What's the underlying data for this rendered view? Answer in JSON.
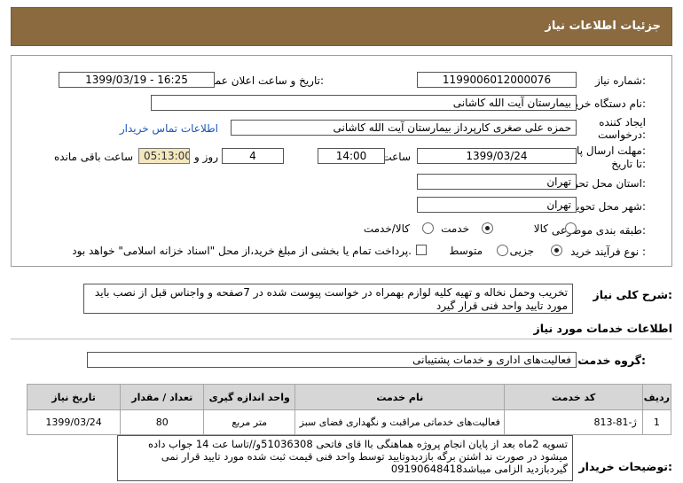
{
  "header": {
    "title": "جزئیات اطلاعات نیاز"
  },
  "form": {
    "need_number_label": "شماره نیاز:",
    "need_number": "1199006012000076",
    "announce_label": "تاریخ و ساعت اعلان عمومی:",
    "announce_value": "1399/03/19 - 16:25",
    "buyer_label": "نام دستگاه خریدار:",
    "buyer_value": "بیمارستان آیت الله کاشانی",
    "creator_label_1": "ایجاد کننده",
    "creator_label_2": "درخواست:",
    "creator_value": "حمزه علی صغری کارپرداز بیمارستان آیت الله کاشانی",
    "contact_link": "اطلاعات تماس خریدار",
    "deadline_label_1": "مهلت ارسال پاسخ:",
    "deadline_label_2": "تا تاریخ:",
    "deadline_date": "1399/03/24",
    "time_label": "ساعت",
    "deadline_time": "14:00",
    "days_value": "4",
    "days_label": "روز و",
    "remaining_value": "05:13:00",
    "remaining_label": "ساعت باقی مانده",
    "province_label": "استان محل تحویل:",
    "province_value": "تهران",
    "city_label": "شهر محل تحویل:",
    "city_value": "تهران",
    "category_label": "طبقه بندی موضوعی:",
    "category_options": [
      "کالا",
      "خدمت",
      "کالا/خدمت"
    ],
    "category_selected": "خدمت",
    "process_label": "نوع فرآیند خرید :",
    "process_options": [
      "جزیی",
      "متوسط"
    ],
    "process_selected": "جزیی",
    "payment_note": "پرداخت تمام یا بخشی از مبلغ خرید،از محل \"اسناد خزانه اسلامی\" خواهد بود."
  },
  "description": {
    "label": "شرح کلی نیاز:",
    "text": "تخریب وحمل نخاله و تهیه کلیه لوازم بهمراه در خواست پیوست شده در 7صفحه و واجناس قبل از نصب باید مورد تایید واحد فنی قرار گیرد"
  },
  "services": {
    "section_title": "اطلاعات خدمات مورد نیاز",
    "group_label": "گروه خدمت:",
    "group_value": "فعالیت‌های اداری و خدمات پشتیبانی",
    "columns": [
      "ردیف",
      "کد خدمت",
      "نام خدمت",
      "واحد اندازه گیری",
      "تعداد / مقدار",
      "تاریخ نیاز"
    ],
    "rows": [
      {
        "index": "1",
        "code": "ژ-81-813",
        "name": "فعالیت‌های خدماتی مراقبت و نگهداری فضای سبز",
        "unit": "متر مربع",
        "qty": "80",
        "date": "1399/03/24"
      }
    ]
  },
  "notes": {
    "label": "توضیحات خریدار:",
    "text": "تسویه 2ماه بعد از پایان انجام پروژه هماهنگی باا قای فاتحی 51036308و//تاسا عت 14 جواب داده میشود در صورت ند اشتن برگه بازدیدوتایید توسط واحد فنی قیمت ثبت شده مورد تایید قرار نمی گیردبازدید الزامی میباشد09190648418"
  }
}
